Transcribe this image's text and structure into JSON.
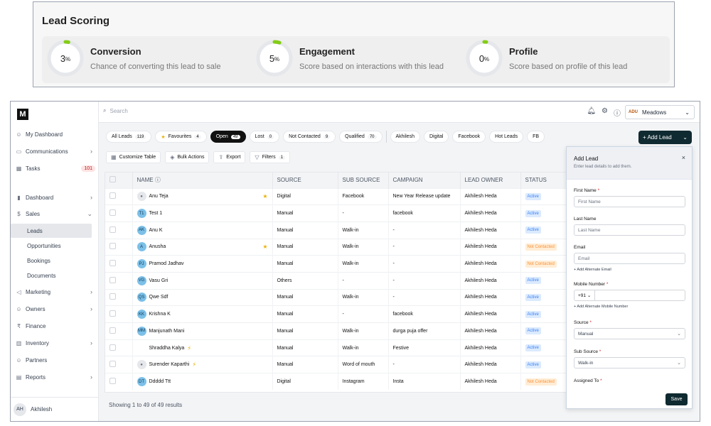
{
  "lead_scoring": {
    "title": "Lead Scoring",
    "scores": [
      {
        "name": "Conversion",
        "value": "3",
        "unit": "%",
        "fraction": 0.03,
        "description": "Chance of converting this lead to sale"
      },
      {
        "name": "Engagement",
        "value": "5",
        "unit": "%",
        "fraction": 0.05,
        "description": "Score based on interactions with this lead"
      },
      {
        "name": "Profile",
        "value": "0",
        "unit": "%",
        "fraction": 0.0,
        "description": "Score based on profile of this lead"
      }
    ],
    "accent": "#84cc16"
  },
  "sidebar": {
    "logo": "M",
    "items": [
      {
        "label": "My Dashboard",
        "icon": "user-icon"
      },
      {
        "label": "Communications",
        "icon": "chat-icon"
      },
      {
        "label": "Tasks",
        "icon": "calendar-icon",
        "badge": "101"
      },
      {
        "label": "Dashboard",
        "icon": "bar-chart-icon"
      },
      {
        "label": "Sales",
        "icon": "dollar-icon"
      },
      {
        "label": "Leads"
      },
      {
        "label": "Opportunities"
      },
      {
        "label": "Bookings"
      },
      {
        "label": "Documents"
      },
      {
        "label": "Marketing",
        "icon": "megaphone-icon"
      },
      {
        "label": "Owners",
        "icon": "people-icon"
      },
      {
        "label": "Finance",
        "icon": "rupee-icon"
      },
      {
        "label": "Inventory",
        "icon": "building-icon"
      },
      {
        "label": "Partners",
        "icon": "people-icon"
      },
      {
        "label": "Reports",
        "icon": "report-icon"
      }
    ],
    "user": {
      "initials": "AH",
      "name": "Akhilesh"
    }
  },
  "topbar": {
    "search_placeholder": "Search",
    "org_name": "Meadows",
    "org_logo_text": "ADU"
  },
  "chips": [
    {
      "label": "All Leads",
      "count": "119"
    },
    {
      "label": "Favourites",
      "count": "4"
    },
    {
      "label": "Open",
      "count": "49",
      "active": true
    },
    {
      "label": "Lost",
      "count": "0"
    },
    {
      "label": "Not Contacted",
      "count": "9"
    },
    {
      "label": "Qualified",
      "count": "70"
    },
    {
      "label": "Akhilesh"
    },
    {
      "label": "Digital"
    },
    {
      "label": "Facebook"
    },
    {
      "label": "Hot Leads"
    },
    {
      "label": "FB"
    }
  ],
  "add_lead_button": "+ Add Lead",
  "tools": {
    "customize": "Customize Table",
    "bulk": "Bulk Actions",
    "export": "Export",
    "filters": "Filters",
    "filters_count": "1"
  },
  "table": {
    "columns": [
      "NAME",
      "SOURCE",
      "SUB SOURCE",
      "CAMPAIGN",
      "LEAD OWNER",
      "STATUS"
    ],
    "rows": [
      {
        "initials": "",
        "name": "Anu Teja",
        "star": true,
        "bolt": false,
        "source": "Digital",
        "sub_source": "Facebook",
        "campaign": "New Year Release update",
        "owner": "Akhilesh Heda",
        "status": "Active"
      },
      {
        "initials": "T1",
        "name": "Test 1",
        "star": false,
        "bolt": false,
        "source": "Manual",
        "sub_source": "-",
        "campaign": "facebook",
        "owner": "Akhilesh Heda",
        "status": "Active"
      },
      {
        "initials": "AK",
        "name": "Anu K",
        "star": false,
        "bolt": false,
        "source": "Manual",
        "sub_source": "Walk-in",
        "campaign": "-",
        "owner": "Akhilesh Heda",
        "status": "Active"
      },
      {
        "initials": "A",
        "name": "Anusha",
        "star": true,
        "bolt": false,
        "source": "Manual",
        "sub_source": "Walk-in",
        "campaign": "-",
        "owner": "Akhilesh Heda",
        "status": "Not Contacted"
      },
      {
        "initials": "PJ",
        "name": "Pramod Jadhav",
        "star": false,
        "bolt": false,
        "source": "Manual",
        "sub_source": "Walk-in",
        "campaign": "-",
        "owner": "Akhilesh Heda",
        "status": "Not Contacted"
      },
      {
        "initials": "VG",
        "name": "Vasu Gri",
        "star": false,
        "bolt": false,
        "source": "Others",
        "sub_source": "-",
        "campaign": "-",
        "owner": "Akhilesh Heda",
        "status": "Active"
      },
      {
        "initials": "QS",
        "name": "Qwe Sdf",
        "star": false,
        "bolt": false,
        "source": "Manual",
        "sub_source": "Walk-in",
        "campaign": "-",
        "owner": "Akhilesh Heda",
        "status": "Active"
      },
      {
        "initials": "KK",
        "name": "Krishna K",
        "star": false,
        "bolt": false,
        "source": "Manual",
        "sub_source": "-",
        "campaign": "facebook",
        "owner": "Akhilesh Heda",
        "status": "Active"
      },
      {
        "initials": "MM",
        "name": "Manjunath Mani",
        "star": false,
        "bolt": false,
        "source": "Manual",
        "sub_source": "Walk-in",
        "campaign": "durga puja offer",
        "owner": "Akhilesh Heda",
        "status": "Active"
      },
      {
        "initials": "",
        "name": "Shraddha Kalya",
        "star": false,
        "bolt": true,
        "source": "Manual",
        "sub_source": "Walk-in",
        "campaign": "Festive",
        "owner": "Akhilesh Heda",
        "status": "Active"
      },
      {
        "initials": "",
        "name": "Surender Kaparthi",
        "star": false,
        "bolt": true,
        "source": "Manual",
        "sub_source": "Word of mouth",
        "campaign": "-",
        "owner": "Akhilesh Heda",
        "status": "Active"
      },
      {
        "initials": "DT",
        "name": "Ddddd Ttt",
        "star": false,
        "bolt": false,
        "source": "Digital",
        "sub_source": "Instagram",
        "campaign": "Insta",
        "owner": "Akhilesh Heda",
        "status": "Not Contacted"
      }
    ]
  },
  "footer_text": "Showing 1 to 49 of 49 results",
  "panel": {
    "title": "Add Lead",
    "subtitle": "Enter lead details to add them.",
    "first_name_label": "First Name",
    "first_name_placeholder": "First Name",
    "last_name_label": "Last Name",
    "last_name_placeholder": "Last Name",
    "email_label": "Email",
    "email_placeholder": "Email",
    "add_email_link": "+ Add Alternate Email",
    "mobile_label": "Mobile Number",
    "country_code": "+91",
    "add_mobile_link": "+ Add Alternate Mobile Number",
    "source_label": "Source",
    "source_value": "Manual",
    "sub_source_label": "Sub Source",
    "sub_source_value": "Walk-in",
    "assigned_label": "Assigned To",
    "save": "Save"
  }
}
